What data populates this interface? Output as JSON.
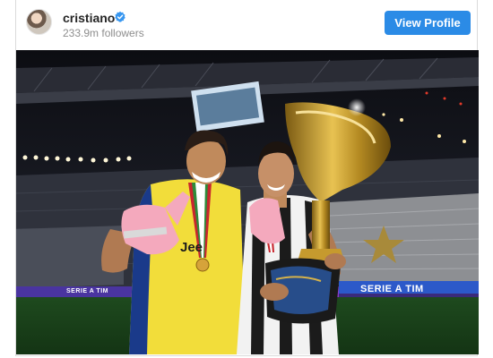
{
  "post": {
    "username": "cristiano",
    "followers": "233.9m followers",
    "view_profile_label": "View Profile"
  },
  "photo": {
    "banner_left": "SERIE A TIM",
    "banner_right": "SERIE A TIM",
    "jersey_text": "Jee"
  },
  "colors": {
    "accent": "#2b8be6",
    "verified": "#3897f0"
  },
  "icons": {
    "verified": "verified-badge-icon",
    "avatar": "profile-avatar"
  }
}
